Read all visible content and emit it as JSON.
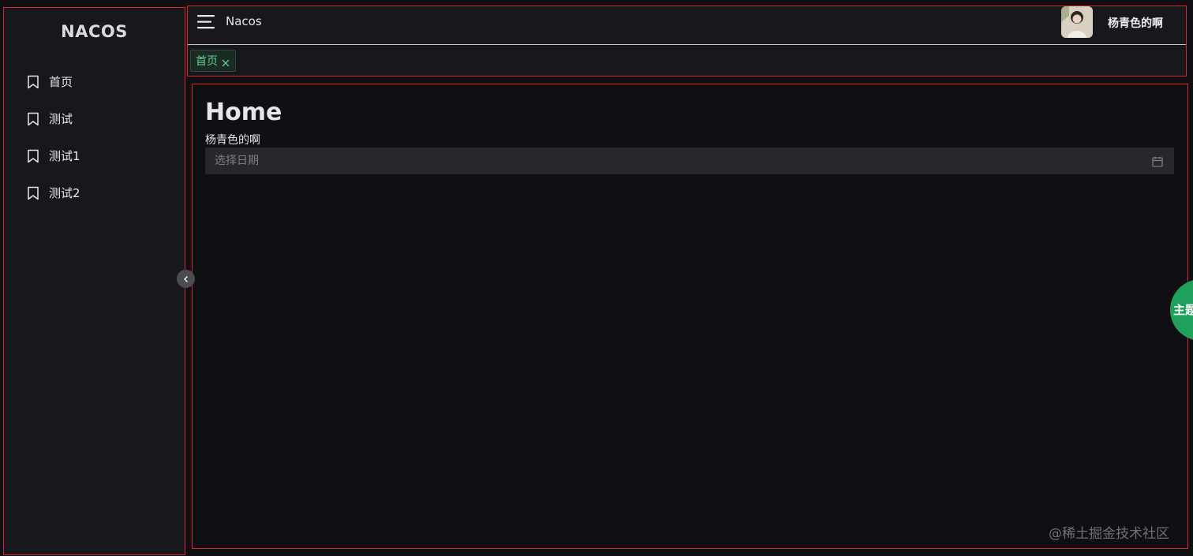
{
  "sidebar": {
    "logo": "NACOS",
    "items": [
      {
        "label": "首页",
        "icon": "bookmark-icon"
      },
      {
        "label": "测试",
        "icon": "bookmark-icon"
      },
      {
        "label": "测试1",
        "icon": "bookmark-icon"
      },
      {
        "label": "测试2",
        "icon": "bookmark-icon"
      }
    ],
    "collapse_icon": "chevron-left-icon"
  },
  "header": {
    "menu_icon": "hamburger-icon",
    "brand": "Nacos",
    "user": {
      "avatar_icon": "avatar-photo",
      "name": "杨青色的啊"
    },
    "tabs": [
      {
        "label": "首页",
        "active": true,
        "close_icon": "close-icon"
      }
    ]
  },
  "main": {
    "title": "Home",
    "subtext": "杨青色的啊",
    "date_picker": {
      "placeholder": "选择日期",
      "value": "",
      "icon": "calendar-icon"
    }
  },
  "theme_button": {
    "label": "主题"
  },
  "watermark": "@稀土掘金技术社区",
  "colors": {
    "border_debug": "#e0242b",
    "accent_green": "#1fa15c",
    "tab_text": "#5ccf8f",
    "sidebar_bg": "#18181c",
    "page_bg": "#101014"
  }
}
